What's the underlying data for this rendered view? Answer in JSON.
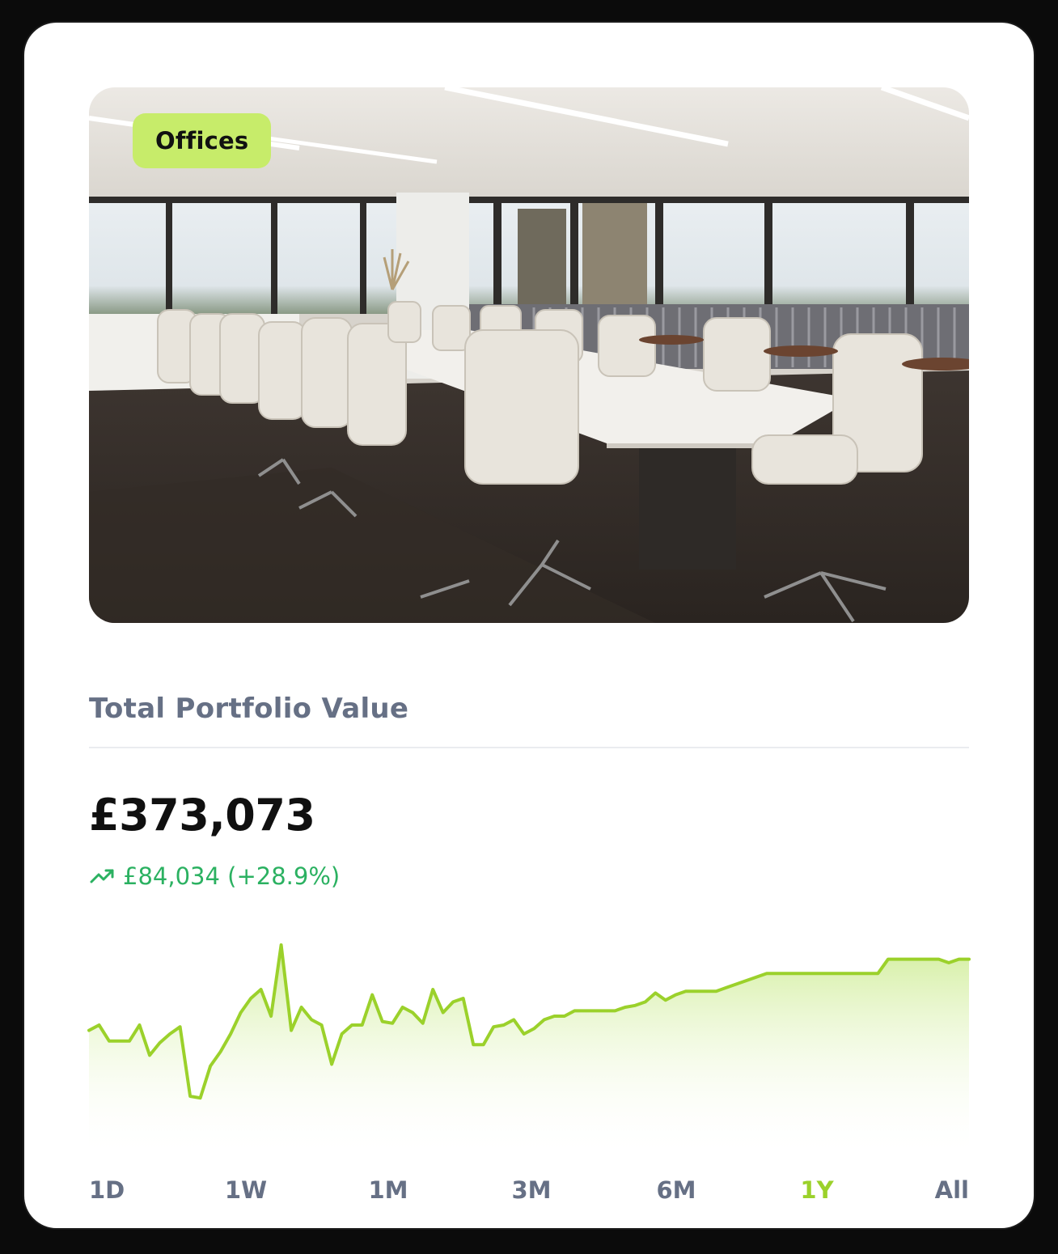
{
  "card": {
    "tag": "Offices",
    "image_subject": "conference-room-photo",
    "title": "Total Portfolio Value",
    "value": "£373,073",
    "change": {
      "icon": "trending-up-icon",
      "text": "£84,034 (+28.9%)",
      "color": "#2bb161"
    },
    "accent": "#9bd12b",
    "tag_color": "#c7ec6a"
  },
  "ranges": {
    "items": [
      "1D",
      "1W",
      "1M",
      "3M",
      "6M",
      "1Y",
      "All"
    ],
    "selected": "1Y"
  },
  "chart_data": {
    "type": "area",
    "xlabel": "",
    "ylabel": "",
    "grid": false,
    "series": [
      {
        "values": [
          242,
          245,
          236,
          236,
          236,
          245,
          228,
          235,
          240,
          244,
          205,
          204,
          222,
          230,
          240,
          252,
          260,
          265,
          250,
          290,
          242,
          255,
          248,
          245,
          223,
          240,
          245,
          245,
          262,
          247,
          246,
          255,
          252,
          246,
          265,
          252,
          258,
          260,
          234,
          234,
          244,
          245,
          248,
          240,
          243,
          248,
          250,
          250,
          253,
          253,
          253,
          253,
          253,
          255,
          256,
          258,
          263,
          259,
          262,
          264,
          264,
          264,
          264,
          266,
          268,
          270,
          272,
          274,
          274,
          274,
          274,
          274,
          274,
          274,
          274,
          274,
          274,
          274,
          274,
          282,
          282,
          282,
          282,
          282,
          282,
          280,
          282,
          282
        ]
      }
    ],
    "ylim": [
      170,
      300
    ]
  }
}
